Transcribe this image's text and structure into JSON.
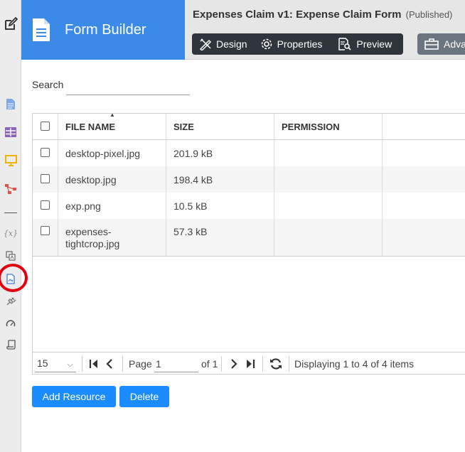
{
  "brand": {
    "title": "Form Builder",
    "color": "#3c8ae8"
  },
  "header": {
    "form_title": "Expenses Claim v1: Expense Claim Form",
    "status": "(Published)",
    "toolbar": [
      {
        "label": "Design",
        "icon": "design-icon"
      },
      {
        "label": "Properties",
        "icon": "gear-icon"
      },
      {
        "label": "Preview",
        "icon": "preview-icon"
      }
    ],
    "advanced_label": "Adva"
  },
  "rail": {
    "icons": [
      "edit-icon",
      "document-icon",
      "table-icon",
      "monitor-icon",
      "workflow-icon",
      "variables-icon",
      "translate-icon",
      "resources-icon",
      "plugin-icon",
      "dashboard-icon",
      "script-icon"
    ],
    "variables_glyph": "{x}",
    "highlighted": "resources-icon"
  },
  "search": {
    "label": "Search",
    "value": ""
  },
  "table": {
    "columns": [
      "FILE NAME",
      "SIZE",
      "PERMISSION"
    ],
    "rows": [
      {
        "name": "desktop-pixel.jpg",
        "size": "201.9 kB",
        "permission": ""
      },
      {
        "name": "desktop.jpg",
        "size": "198.4 kB",
        "permission": ""
      },
      {
        "name": "exp.png",
        "size": "10.5 kB",
        "permission": ""
      },
      {
        "name": "expenses-tightcrop.jpg",
        "name_lines": [
          "expenses-",
          "tightcrop.jpg"
        ],
        "size": "57.3 kB",
        "permission": ""
      }
    ]
  },
  "pager": {
    "page_size": "15",
    "page_label": "Page",
    "page_value": "1",
    "of_label": "of 1",
    "info": "Displaying 1 to 4 of 4 items"
  },
  "actions": {
    "add_label": "Add Resource",
    "delete_label": "Delete",
    "button_color": "#1a8cff"
  }
}
